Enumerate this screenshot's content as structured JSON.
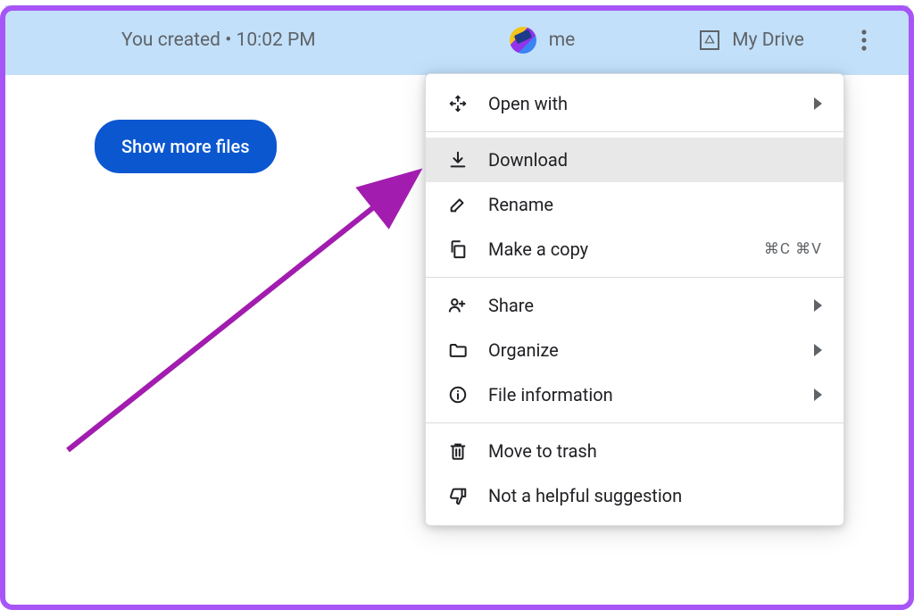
{
  "header": {
    "info_text": "You created • 10:02 PM",
    "owner_label": "me",
    "location_label": "My Drive"
  },
  "button": {
    "show_more": "Show more files"
  },
  "menu": {
    "open_with": "Open with",
    "download": "Download",
    "rename": "Rename",
    "make_copy": "Make a copy",
    "make_copy_shortcut": "⌘C ⌘V",
    "share": "Share",
    "organize": "Organize",
    "file_info": "File information",
    "trash": "Move to trash",
    "not_helpful": "Not a helpful suggestion"
  }
}
